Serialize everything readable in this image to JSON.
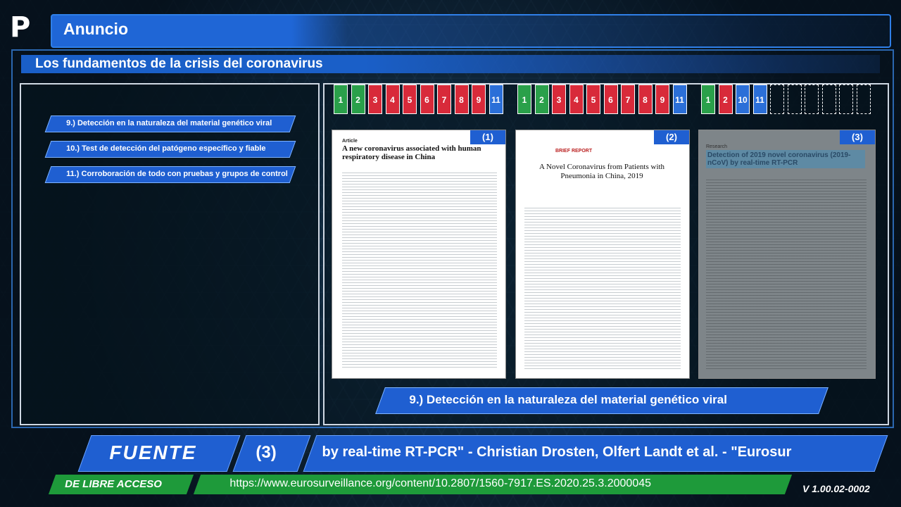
{
  "header": {
    "logo_text": "P",
    "title": "Anuncio",
    "subtitle": "Los fundamentos de la crisis del coronavirus"
  },
  "steps": [
    "9.) Detección en la naturaleza del material genético viral",
    "10.) Test de detección del patógeno específico y fiable",
    "11.) Corroboración de todo con pruebas y grupos de control"
  ],
  "tracker_groups": [
    {
      "cells": [
        {
          "n": "1",
          "c": "g"
        },
        {
          "n": "2",
          "c": "g"
        },
        {
          "n": "3",
          "c": "r"
        },
        {
          "n": "4",
          "c": "r"
        },
        {
          "n": "5",
          "c": "r"
        },
        {
          "n": "6",
          "c": "r"
        },
        {
          "n": "7",
          "c": "r"
        },
        {
          "n": "8",
          "c": "r"
        },
        {
          "n": "9",
          "c": "r"
        },
        {
          "n": "11",
          "c": "b"
        }
      ]
    },
    {
      "cells": [
        {
          "n": "1",
          "c": "g"
        },
        {
          "n": "2",
          "c": "g"
        },
        {
          "n": "3",
          "c": "r"
        },
        {
          "n": "4",
          "c": "r"
        },
        {
          "n": "5",
          "c": "r"
        },
        {
          "n": "6",
          "c": "r"
        },
        {
          "n": "7",
          "c": "r"
        },
        {
          "n": "8",
          "c": "r"
        },
        {
          "n": "9",
          "c": "r"
        },
        {
          "n": "11",
          "c": "b"
        }
      ]
    },
    {
      "cells": [
        {
          "n": "1",
          "c": "g"
        },
        {
          "n": "2",
          "c": "r"
        },
        {
          "n": "10",
          "c": "b"
        },
        {
          "n": "11",
          "c": "b"
        },
        {
          "n": "",
          "c": "e"
        },
        {
          "n": "",
          "c": "e"
        },
        {
          "n": "",
          "c": "e"
        },
        {
          "n": "",
          "c": "e"
        },
        {
          "n": "",
          "c": "e"
        },
        {
          "n": "",
          "c": "e"
        }
      ]
    }
  ],
  "documents": [
    {
      "tag": "(1)",
      "label": "Article",
      "title": "A new coronavirus associated with human respiratory disease in China"
    },
    {
      "tag": "(2)",
      "label": "BRIEF REPORT",
      "title": "A Novel Coronavirus from Patients with Pneumonia in China, 2019"
    },
    {
      "tag": "(3)",
      "label": "Research",
      "title": "Detection of 2019 novel coronavirus (2019-nCoV) by real-time RT-PCR"
    }
  ],
  "caption": "9.) Detección en la naturaleza del material genético viral",
  "source": {
    "label": "FUENTE",
    "number": "(3)",
    "ticker": "by real-time RT-PCR\"  -  Christian Drosten, Olfert Landt et al.  -  \"Eurosur",
    "access": "DE LIBRE ACCESO",
    "url": "https://www.eurosurveillance.org/content/10.2807/1560-7917.ES.2020.25.3.2000045"
  },
  "version": "V 1.00.02-0002"
}
